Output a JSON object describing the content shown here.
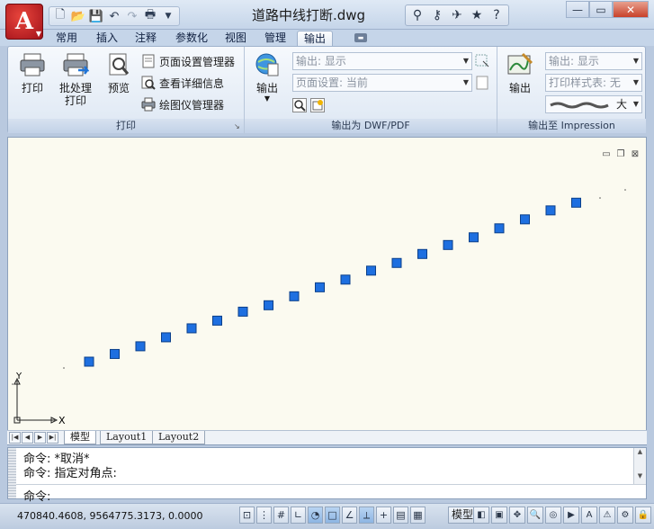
{
  "title_bar": {
    "app_button_label": "A",
    "document_title": "道路中线打断.dwg"
  },
  "quick_access": {
    "icons": [
      "new-icon",
      "open-icon",
      "save-icon",
      "undo-icon",
      "redo-icon",
      "plot-icon",
      "customize-dropdown-icon"
    ]
  },
  "help_tools": {
    "icons": [
      "binoculars-icon",
      "key-icon",
      "satellite-icon",
      "star-icon",
      "help-icon"
    ]
  },
  "ribbon_tabs": [
    {
      "label": "常用",
      "active": false
    },
    {
      "label": "插入",
      "active": false
    },
    {
      "label": "注释",
      "active": false
    },
    {
      "label": "参数化",
      "active": false
    },
    {
      "label": "视图",
      "active": false
    },
    {
      "label": "管理",
      "active": false
    },
    {
      "label": "输出",
      "active": true
    }
  ],
  "panels": {
    "plot": {
      "title": "打印",
      "plot_label": "打印",
      "batch_label_line1": "批处理",
      "batch_label_line2": "打印",
      "preview_label": "预览",
      "page_setup_manager": "页面设置管理器",
      "view_details": "查看详细信息",
      "plotter_manager": "绘图仪管理器"
    },
    "export_dwf": {
      "title": "输出为 DWF/PDF",
      "export_label": "输出",
      "export_combo": "输出: 显示",
      "page_setup_combo": "页面设置: 当前"
    },
    "impression": {
      "title": "输出至 Impression",
      "export_label": "输出",
      "export_combo": "输出: 显示",
      "plot_style_combo": "打印样式表: 无",
      "size_label": "大"
    }
  },
  "drawing": {
    "ucs_x": "X",
    "ucs_y": "Y",
    "points": [
      {
        "x": 0,
        "y": 0
      },
      {
        "x": 1,
        "y": 0.3
      },
      {
        "x": 2,
        "y": 0.6
      },
      {
        "x": 3,
        "y": 0.95
      },
      {
        "x": 4,
        "y": 1.3
      },
      {
        "x": 5,
        "y": 1.6
      },
      {
        "x": 6,
        "y": 1.95
      },
      {
        "x": 7,
        "y": 2.2
      },
      {
        "x": 8,
        "y": 2.55
      },
      {
        "x": 9,
        "y": 2.9
      },
      {
        "x": 10,
        "y": 3.2
      },
      {
        "x": 11,
        "y": 3.55
      },
      {
        "x": 12,
        "y": 3.85
      },
      {
        "x": 13,
        "y": 4.2
      },
      {
        "x": 14,
        "y": 4.55
      },
      {
        "x": 15,
        "y": 4.85
      },
      {
        "x": 16,
        "y": 5.2
      },
      {
        "x": 17,
        "y": 5.55
      },
      {
        "x": 18,
        "y": 5.9
      },
      {
        "x": 19,
        "y": 6.2
      }
    ],
    "grip_color": "#1e6fe0",
    "background": "#fbfaf0"
  },
  "layout_tabs": [
    {
      "label": "模型",
      "active": true
    },
    {
      "label": "Layout1",
      "active": false
    },
    {
      "label": "Layout2",
      "active": false
    }
  ],
  "command": {
    "history": [
      "命令: *取消*",
      "命令: 指定对角点:"
    ],
    "prompt": "命令:"
  },
  "status_bar": {
    "coordinates": "470840.4608, 9564775.3173, 0.0000",
    "model_label": "模型"
  }
}
